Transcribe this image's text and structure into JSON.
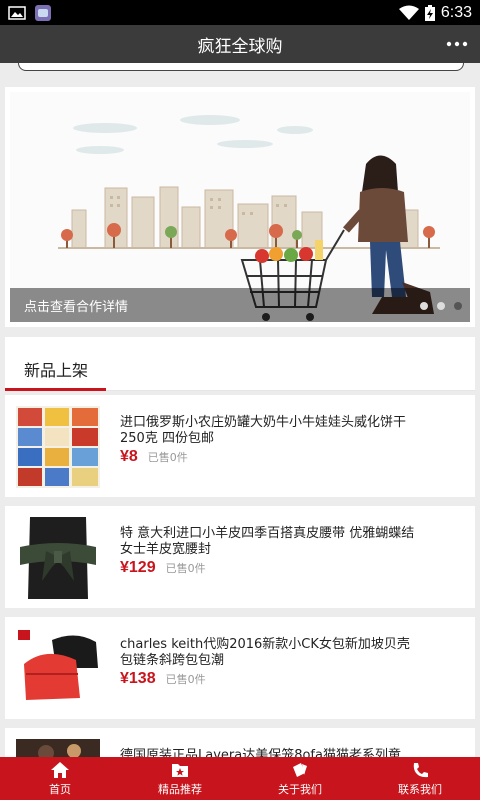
{
  "status_bar": {
    "time": "6:33",
    "left_icons": [
      "image-notification-icon",
      "app-notification-icon"
    ],
    "right_icons": [
      "wifi-icon",
      "battery-charging-icon"
    ]
  },
  "app_bar": {
    "title": "疯狂全球购",
    "more_icon": "more-dots-icon"
  },
  "banner": {
    "caption": "点击查看合作详情",
    "dots_total": 3,
    "active_dot": 3
  },
  "section": {
    "title": "新品上架"
  },
  "products": [
    {
      "name": "进口俄罗斯小农庄奶罐大奶牛小牛娃娃头威化饼干250克 四份包邮",
      "price": "¥8",
      "sold": "已售0件"
    },
    {
      "name": "特 意大利进口小羊皮四季百搭真皮腰带 优雅蝴蝶结女士羊皮宽腰封",
      "price": "¥129",
      "sold": "已售0件"
    },
    {
      "name": "charles keith代购2016新款小CK女包新加坡贝壳包链条斜跨包包潮",
      "price": "¥138",
      "sold": "已售0件"
    },
    {
      "name": "德国原装正品Lavera达美保笼8ofa猫猫老系列童",
      "price": "",
      "sold": ""
    }
  ],
  "tabs": [
    {
      "label": "首页",
      "icon": "home-icon"
    },
    {
      "label": "精品推荐",
      "icon": "star-folder-icon"
    },
    {
      "label": "关于我们",
      "icon": "cards-icon"
    },
    {
      "label": "联系我们",
      "icon": "phone-icon"
    }
  ],
  "colors": {
    "accent": "#c8141c",
    "app_bar": "#3b3b3b",
    "status_bar": "#000000",
    "background": "#ececec"
  }
}
